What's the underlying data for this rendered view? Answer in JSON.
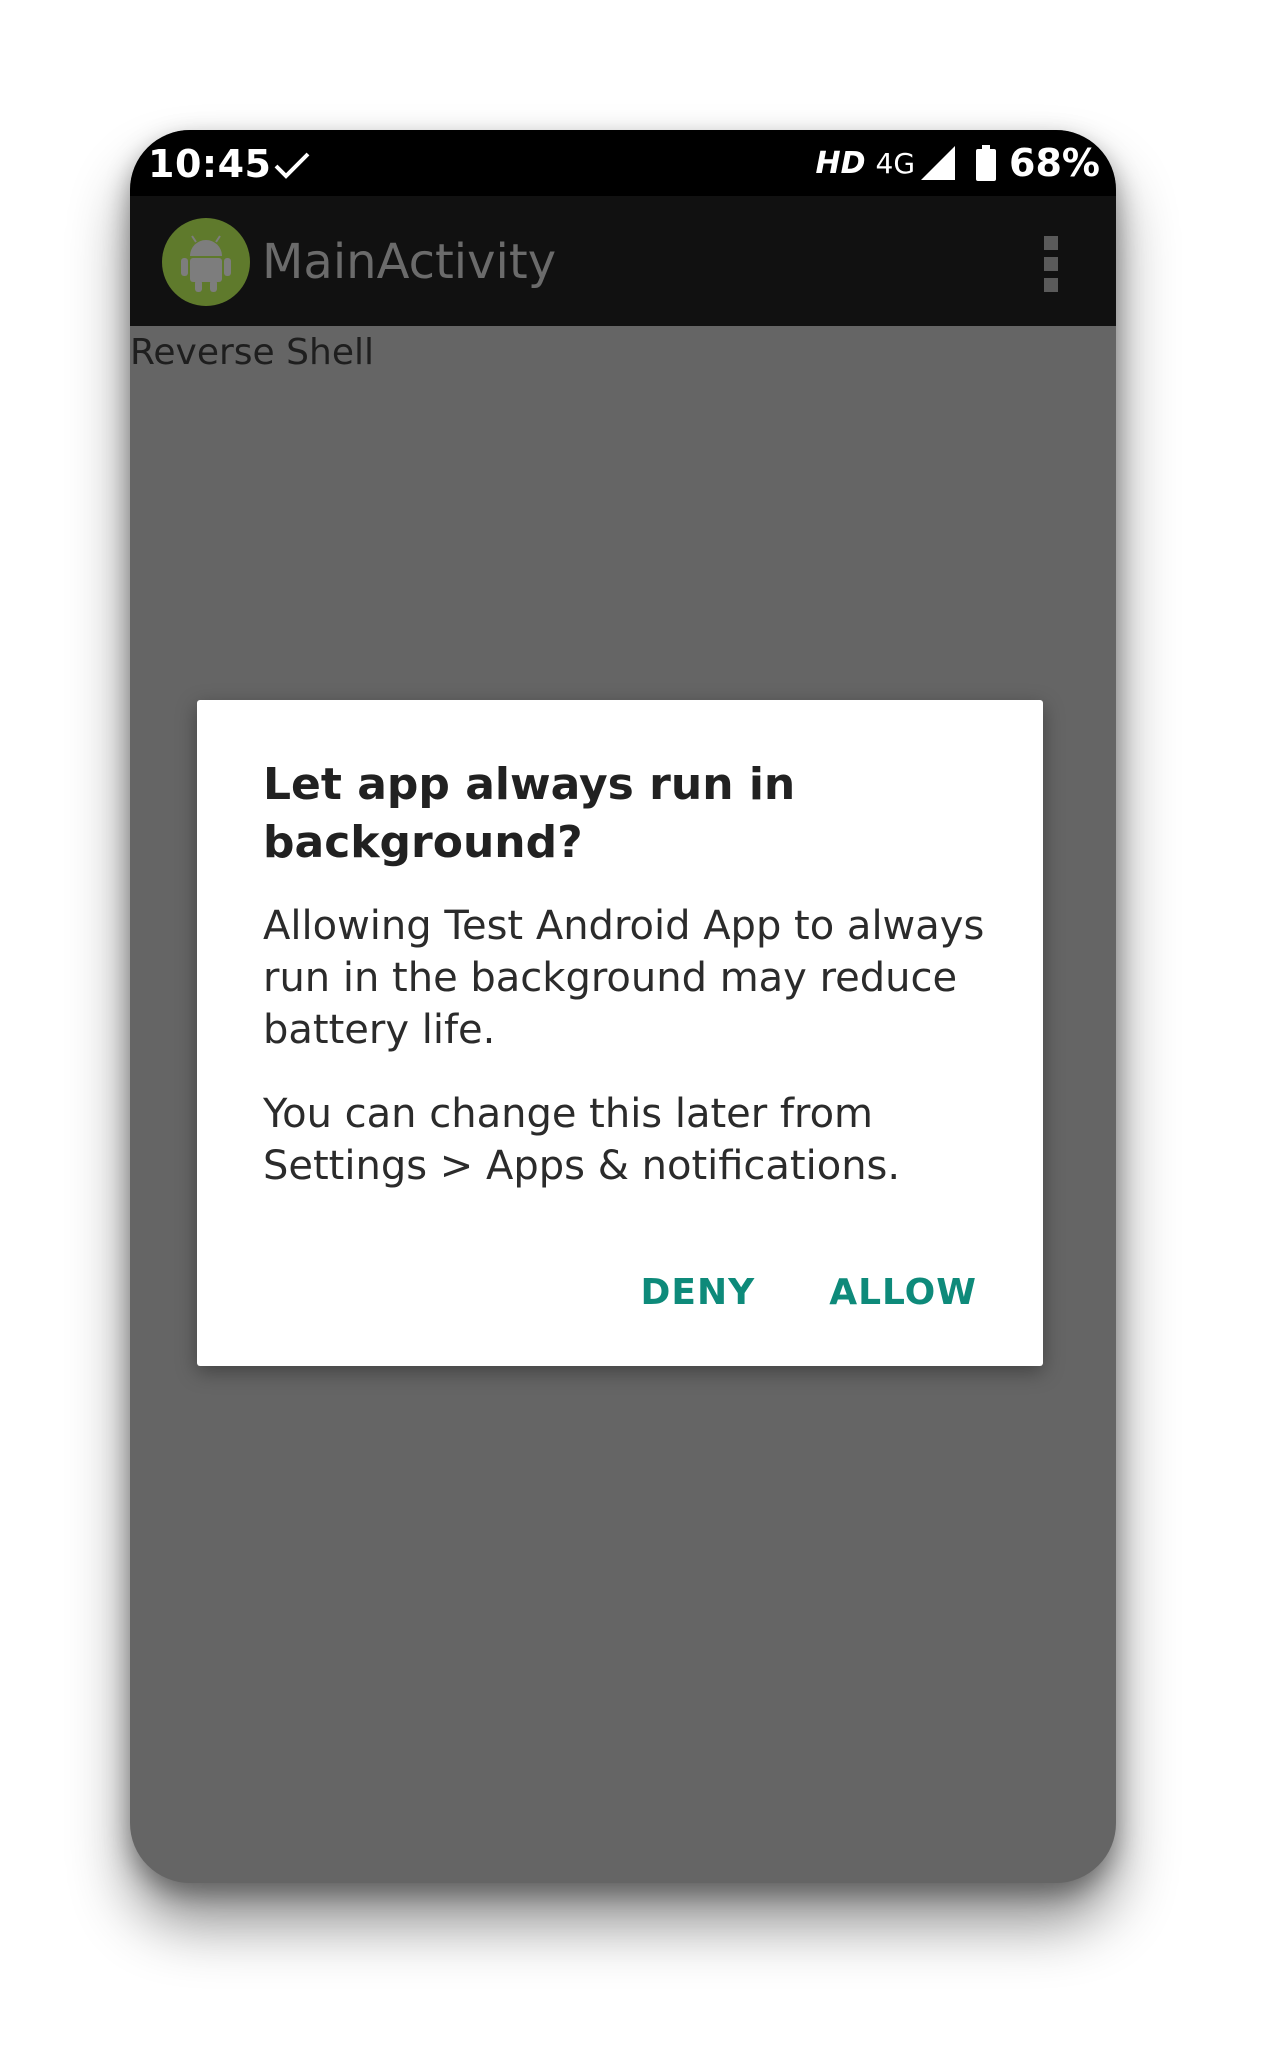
{
  "status_bar": {
    "time": "10:45",
    "hd": "HD",
    "network": "4G",
    "battery_percent": "68%"
  },
  "app_bar": {
    "title": "MainActivity"
  },
  "content": {
    "label": "Reverse Shell"
  },
  "dialog": {
    "title": "Let app always run in background?",
    "body_paragraph_1": "Allowing Test Android App to always run in the background may reduce battery life.",
    "body_paragraph_2": "You can change this later from Settings > Apps & notifications.",
    "deny_label": "DENY",
    "allow_label": "ALLOW"
  },
  "colors": {
    "accent": "#0e8a7a",
    "scrim": "#656565",
    "app_icon": "#5f7a2c"
  }
}
